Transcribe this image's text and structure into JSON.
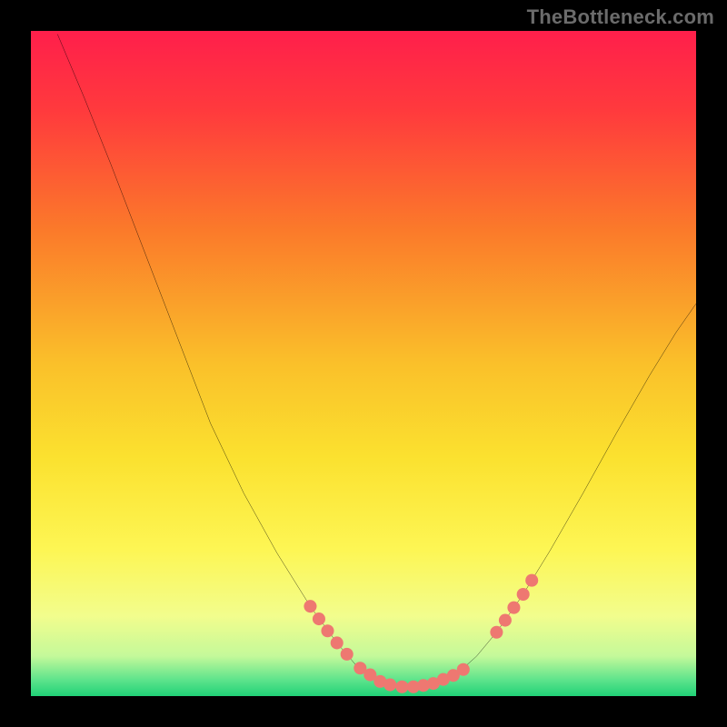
{
  "watermark": "TheBottleneck.com",
  "chart_data": {
    "type": "line",
    "title": "",
    "xlabel": "",
    "ylabel": "",
    "xlim": [
      0,
      100
    ],
    "ylim": [
      0,
      100
    ],
    "grid": false,
    "legend": false,
    "background_gradient": {
      "stops": [
        {
          "offset": 0.0,
          "color": "#ff1f4b"
        },
        {
          "offset": 0.12,
          "color": "#ff3a3d"
        },
        {
          "offset": 0.3,
          "color": "#fb7a2a"
        },
        {
          "offset": 0.5,
          "color": "#fac02a"
        },
        {
          "offset": 0.64,
          "color": "#fbe12f"
        },
        {
          "offset": 0.78,
          "color": "#fdf654"
        },
        {
          "offset": 0.88,
          "color": "#f2fd8d"
        },
        {
          "offset": 0.94,
          "color": "#c4f99a"
        },
        {
          "offset": 0.975,
          "color": "#5fe48c"
        },
        {
          "offset": 1.0,
          "color": "#20d277"
        }
      ]
    },
    "series": [
      {
        "name": "curve",
        "color": "#000000",
        "stroke_width": 2,
        "points": [
          {
            "x": 4.0,
            "y": 99.5
          },
          {
            "x": 8.0,
            "y": 90.0
          },
          {
            "x": 12.0,
            "y": 80.0
          },
          {
            "x": 17.0,
            "y": 67.0
          },
          {
            "x": 22.0,
            "y": 54.0
          },
          {
            "x": 27.0,
            "y": 41.0
          },
          {
            "x": 32.0,
            "y": 30.5
          },
          {
            "x": 37.0,
            "y": 21.5
          },
          {
            "x": 42.0,
            "y": 13.5
          },
          {
            "x": 46.0,
            "y": 8.0
          },
          {
            "x": 49.0,
            "y": 4.5
          },
          {
            "x": 52.0,
            "y": 2.4
          },
          {
            "x": 55.0,
            "y": 1.5
          },
          {
            "x": 58.0,
            "y": 1.4
          },
          {
            "x": 61.0,
            "y": 1.9
          },
          {
            "x": 64.0,
            "y": 3.3
          },
          {
            "x": 67.0,
            "y": 6.0
          },
          {
            "x": 70.0,
            "y": 9.6
          },
          {
            "x": 74.0,
            "y": 15.3
          },
          {
            "x": 78.0,
            "y": 21.8
          },
          {
            "x": 83.0,
            "y": 30.5
          },
          {
            "x": 88.0,
            "y": 39.5
          },
          {
            "x": 93.0,
            "y": 48.2
          },
          {
            "x": 97.0,
            "y": 54.7
          },
          {
            "x": 100.0,
            "y": 59.0
          }
        ]
      },
      {
        "name": "markers",
        "color": "#ee7871",
        "marker_radius": 7,
        "points": [
          {
            "x": 42.0,
            "y": 13.5
          },
          {
            "x": 43.3,
            "y": 11.6
          },
          {
            "x": 44.6,
            "y": 9.8
          },
          {
            "x": 46.0,
            "y": 8.0
          },
          {
            "x": 47.5,
            "y": 6.3
          },
          {
            "x": 49.5,
            "y": 4.2
          },
          {
            "x": 51.0,
            "y": 3.2
          },
          {
            "x": 52.5,
            "y": 2.2
          },
          {
            "x": 54.0,
            "y": 1.7
          },
          {
            "x": 55.8,
            "y": 1.4
          },
          {
            "x": 57.5,
            "y": 1.4
          },
          {
            "x": 59.0,
            "y": 1.6
          },
          {
            "x": 60.5,
            "y": 1.9
          },
          {
            "x": 62.0,
            "y": 2.5
          },
          {
            "x": 63.5,
            "y": 3.1
          },
          {
            "x": 65.0,
            "y": 4.0
          },
          {
            "x": 70.0,
            "y": 9.6
          },
          {
            "x": 71.3,
            "y": 11.4
          },
          {
            "x": 72.6,
            "y": 13.3
          },
          {
            "x": 74.0,
            "y": 15.3
          },
          {
            "x": 75.3,
            "y": 17.4
          }
        ]
      }
    ]
  }
}
